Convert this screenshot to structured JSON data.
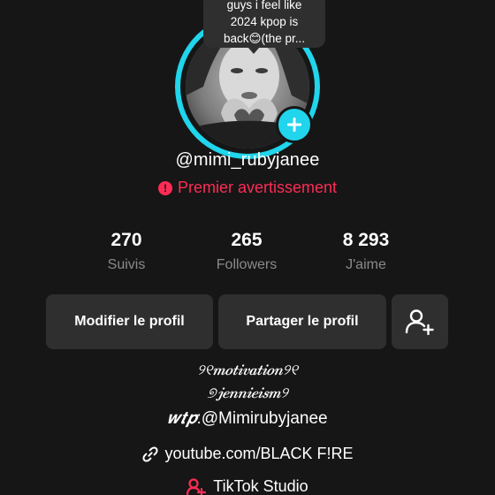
{
  "note": {
    "lines": [
      "guys i feel like",
      "2024 kpop is",
      "back😊(the pr..."
    ]
  },
  "profile": {
    "username": "@mimi_rubyjanee",
    "warning_text": "Premier avertissement",
    "warning_icon": "exclamation-icon"
  },
  "stats": [
    {
      "value": "270",
      "label": "Suivis"
    },
    {
      "value": "265",
      "label": "Followers"
    },
    {
      "value": "8 293",
      "label": "J'aime"
    }
  ],
  "actions": {
    "edit_label": "Modifier le profil",
    "share_label": "Partager le profil",
    "add_friend_icon": "add-user-icon"
  },
  "bio": {
    "line1": "୨୧𝒎𝒐𝒕𝒊𝒗𝒂𝒕𝒊𝒐𝒏୨୧",
    "line2": "୭𝒋𝒆𝒏𝒏𝒊𝒆𝒊𝒔𝒎୨",
    "line3_prefix": "𝒘𝒕𝒑",
    "line3_handle": ":@Mimirubyjanee"
  },
  "link": {
    "icon": "link-icon",
    "text": "youtube.com/BLACK F!RE"
  },
  "studio": {
    "icon": "tiktok-studio-icon",
    "text": "TikTok Studio"
  },
  "colors": {
    "background": "#161616",
    "ring": "#20d5ec",
    "warning": "#fe2c55",
    "button": "#2f2f2f",
    "muted_text": "#8a8a8a"
  }
}
